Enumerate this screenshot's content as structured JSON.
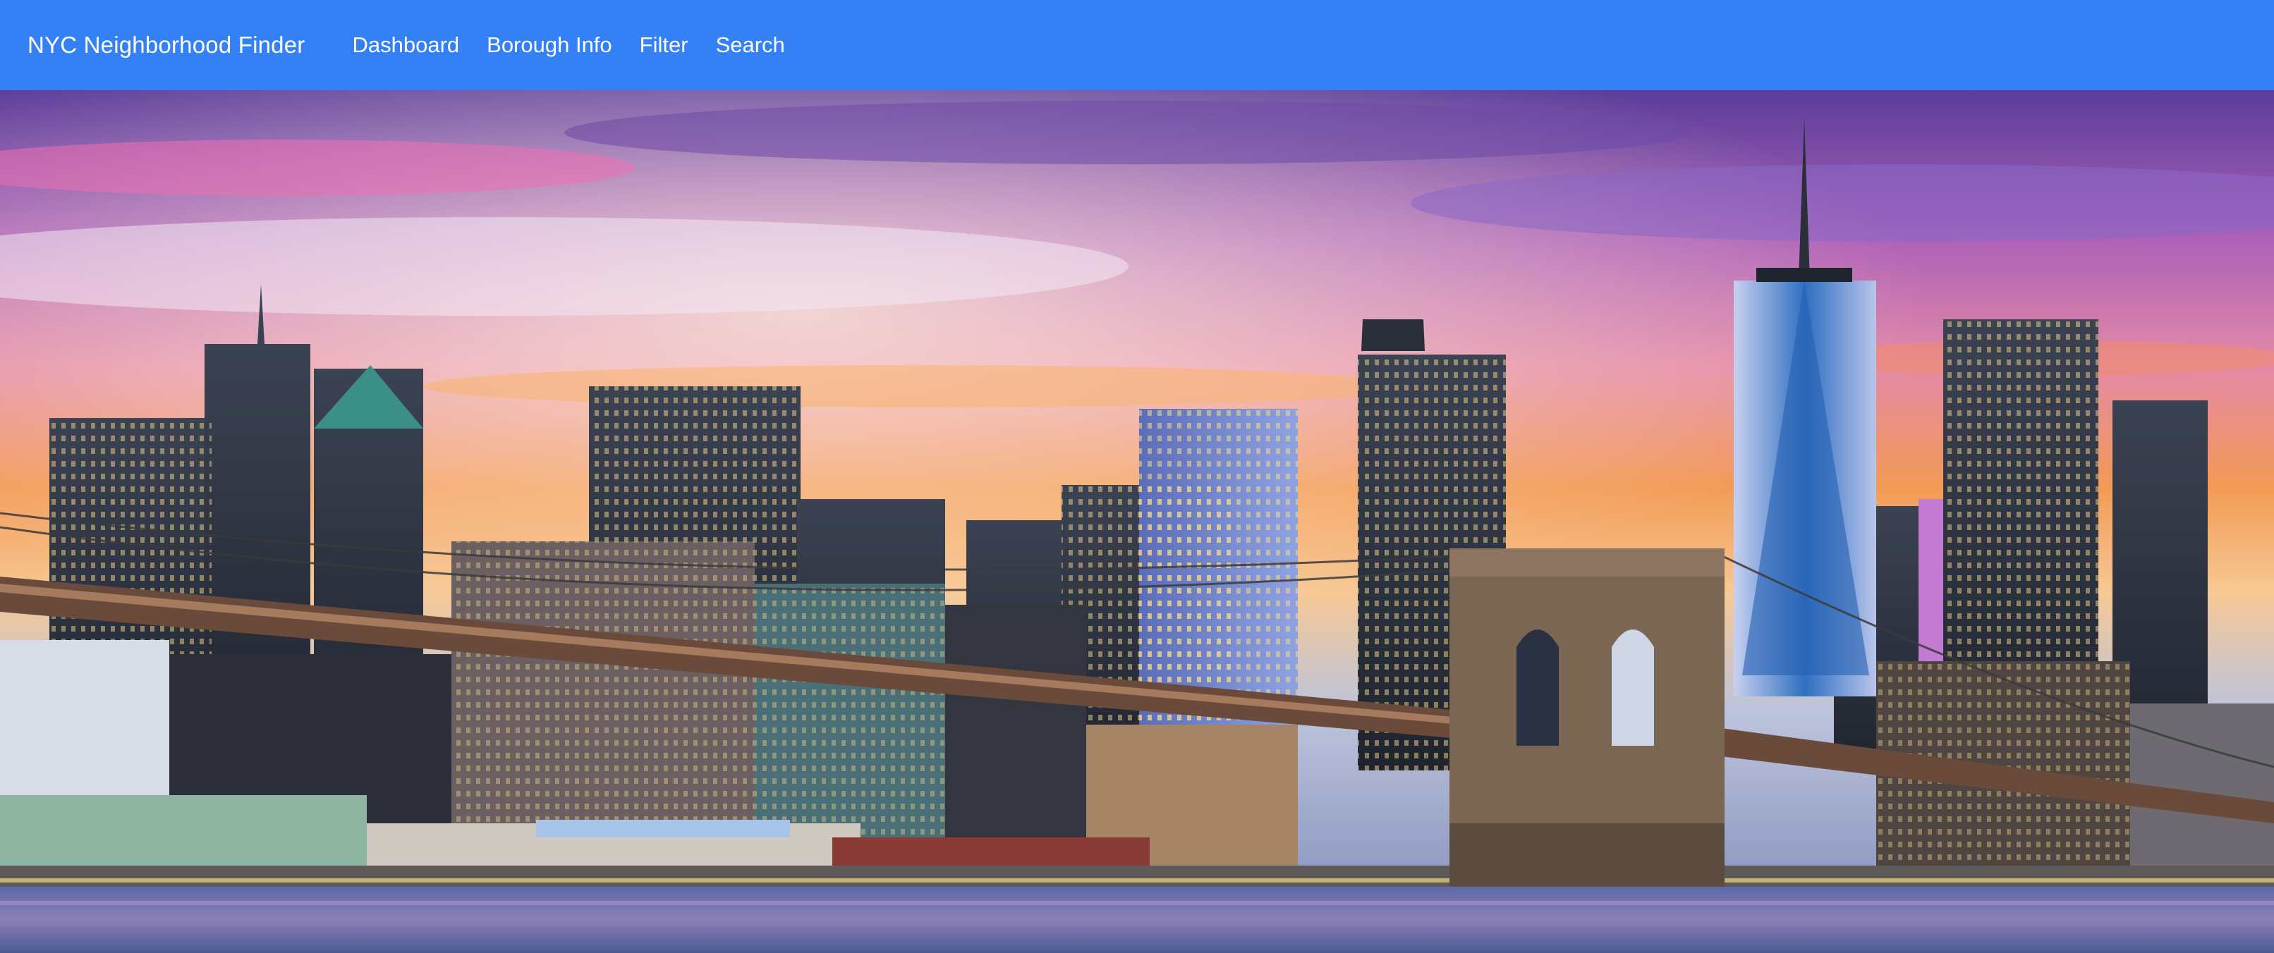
{
  "navbar": {
    "brand": "NYC Neighborhood Finder",
    "links": [
      "Dashboard",
      "Borough Info",
      "Filter",
      "Search"
    ],
    "background_color": "#3480f5",
    "text_color": "#ffffff"
  },
  "hero": {
    "image_subject": "lower-manhattan-skyline-brooklyn-bridge-sunset"
  }
}
